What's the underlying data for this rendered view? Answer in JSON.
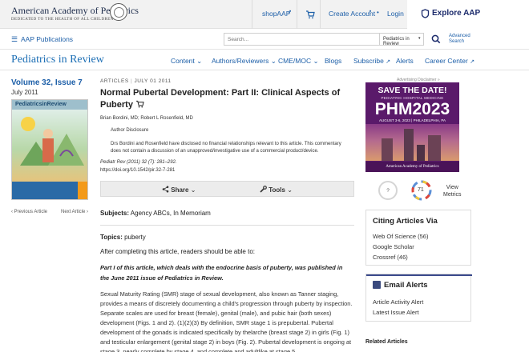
{
  "header": {
    "org_name": "American Academy of Pediatrics",
    "org_tagline": "DEDICATED TO THE HEALTH OF ALL CHILDREN®",
    "shop_label": "shopAAP",
    "create_account_label": "Create Account",
    "login_label": "Login",
    "explore_label": "Explore AAP"
  },
  "subnav": {
    "publications_label": "AAP Publications",
    "search_placeholder": "Search...",
    "search_scope": "Pediatrics in Review",
    "advanced_search_line1": "Advanced",
    "advanced_search_line2": "Search"
  },
  "journal": {
    "title": "Pediatrics in Review",
    "nav": [
      "Content",
      "Authors/Reviewers",
      "CME/MOC",
      "Blogs",
      "Subscribe",
      "Alerts",
      "Career Center"
    ]
  },
  "issue": {
    "volume": "Volume 32, Issue 7",
    "month": "July 2011",
    "cover_title": "PediatricsinReview",
    "prev_label": "‹ Previous Article",
    "next_label": "Next Article ›"
  },
  "article": {
    "type": "ARTICLES",
    "date": "JULY 01 2011",
    "title": "Normal Pubertal Development: Part II: Clinical Aspects of Puberty",
    "authors": "Brian Bordini, MD; Robert L Rosenfield, MD",
    "disclosure_heading": "Author Disclosure",
    "disclosure_text": "Drs Bordini and Rosenfield have disclosed no financial relationships relevant to this article. This commentary does not contain a discussion of an unapproved/investigative use of a commercial product/device.",
    "citation": "Pediatr Rev (2011) 32 (7): 281–292.",
    "doi": "https://doi.org/10.1542/pir.32-7-281",
    "share_label": "Share",
    "tools_label": "Tools",
    "subjects_label": "Subjects:",
    "subjects_value": "Agency ABCs, In Memoriam",
    "topics_label": "Topics:",
    "topics_value": "puberty",
    "intro": "After completing this article, readers should be able to:",
    "part1_note": "Part I of this article, which deals with the endocrine basis of puberty, was published in the June 2011 issue of Pediatrics in Review.",
    "body": "Sexual Maturity Rating (SMR) stage of sexual development, also known as Tanner staging, provides a means of discretely documenting a child's progression through puberty by inspection. Separate scales are used for breast (female), genital (male), and pubic hair (both sexes) development (Figs. 1 and 2). (1)(2)(3) By definition, SMR stage 1 is prepubertal. Pubertal development of the gonads is indicated specifically by thelarche (breast stage 2) in girls (Fig. 1) and testicular enlargement (genital stage 2) in boys (Fig. 2). Pubertal development is ongoing at stage 3, nearly complete by stage 4, and complete and adultlike at stage 5."
  },
  "sidebar": {
    "ad_label": "Advertising Disclaimer »",
    "ad": {
      "headline": "SAVE THE DATE!",
      "subhead": "PEDIATRIC HOSPITAL MEDICINE",
      "big": "PHM2023",
      "dates": "AUGUST 3-6, 2023 | PHILADELPHIA, PA",
      "sponsor": "American Academy of Pediatrics"
    },
    "metric_dimensions": "?",
    "altmetric_score": "71",
    "view_metrics_line1": "View",
    "view_metrics_line2": "Metrics",
    "citing_heading": "Citing Articles Via",
    "citing_items": [
      "Web Of Science (56)",
      "Google Scholar",
      "Crossref (46)"
    ],
    "email_heading": "Email Alerts",
    "email_items": [
      "Article Activity Alert",
      "Latest Issue Alert"
    ],
    "related_heading": "Related Articles"
  }
}
